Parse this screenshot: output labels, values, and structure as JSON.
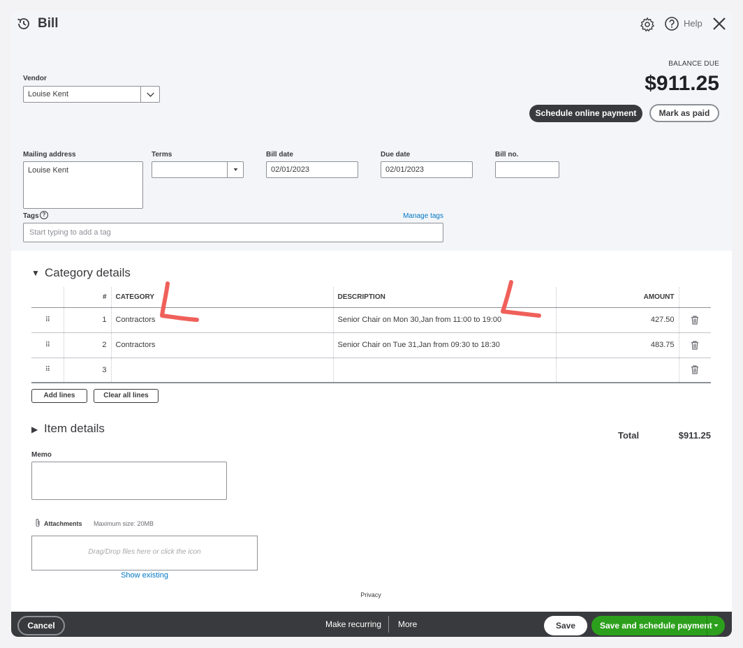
{
  "header": {
    "title": "Bill",
    "help_label": "Help",
    "balance_due_label": "BALANCE DUE",
    "balance_due_amount": "$911.25",
    "schedule_online_payment": "Schedule online payment",
    "mark_as_paid": "Mark as paid"
  },
  "form": {
    "vendor_label": "Vendor",
    "vendor_value": "Louise Kent",
    "mailing_address_label": "Mailing address",
    "mailing_address_value": "Louise Kent",
    "terms_label": "Terms",
    "terms_value": "",
    "bill_date_label": "Bill date",
    "bill_date_value": "02/01/2023",
    "due_date_label": "Due date",
    "due_date_value": "02/01/2023",
    "bill_no_label": "Bill no.",
    "bill_no_value": "",
    "tags_label": "Tags",
    "manage_tags": "Manage tags",
    "tags_placeholder": "Start typing to add a tag"
  },
  "category_details": {
    "title": "Category details",
    "columns": {
      "num": "#",
      "category": "CATEGORY",
      "description": "DESCRIPTION",
      "amount": "AMOUNT"
    },
    "rows": [
      {
        "num": "1",
        "category": "Contractors",
        "description": "Senior Chair on Mon 30,Jan from 11:00 to 19:00",
        "amount": "427.50"
      },
      {
        "num": "2",
        "category": "Contractors",
        "description": "Senior Chair on Tue 31,Jan from 09:30 to 18:30",
        "amount": "483.75"
      },
      {
        "num": "3",
        "category": "",
        "description": "",
        "amount": ""
      }
    ],
    "add_lines": "Add lines",
    "clear_all_lines": "Clear all lines"
  },
  "item_details": {
    "title": "Item details"
  },
  "totals": {
    "total_label": "Total",
    "total_value": "$911.25"
  },
  "memo": {
    "label": "Memo"
  },
  "attachments": {
    "label": "Attachments",
    "max_size": "Maximum size: 20MB",
    "drop_text": "Drag/Drop files here or click the icon",
    "show_existing": "Show existing"
  },
  "privacy": "Privacy",
  "footer": {
    "cancel": "Cancel",
    "make_recurring": "Make recurring",
    "more": "More",
    "save": "Save",
    "save_and_schedule": "Save and schedule payment"
  },
  "colors": {
    "header_bg": "#f4f5f8",
    "footer_bg": "#393a3d",
    "primary_green": "#2ca01c",
    "link_blue": "#0077c5",
    "annotation_red": "#f0605a"
  }
}
